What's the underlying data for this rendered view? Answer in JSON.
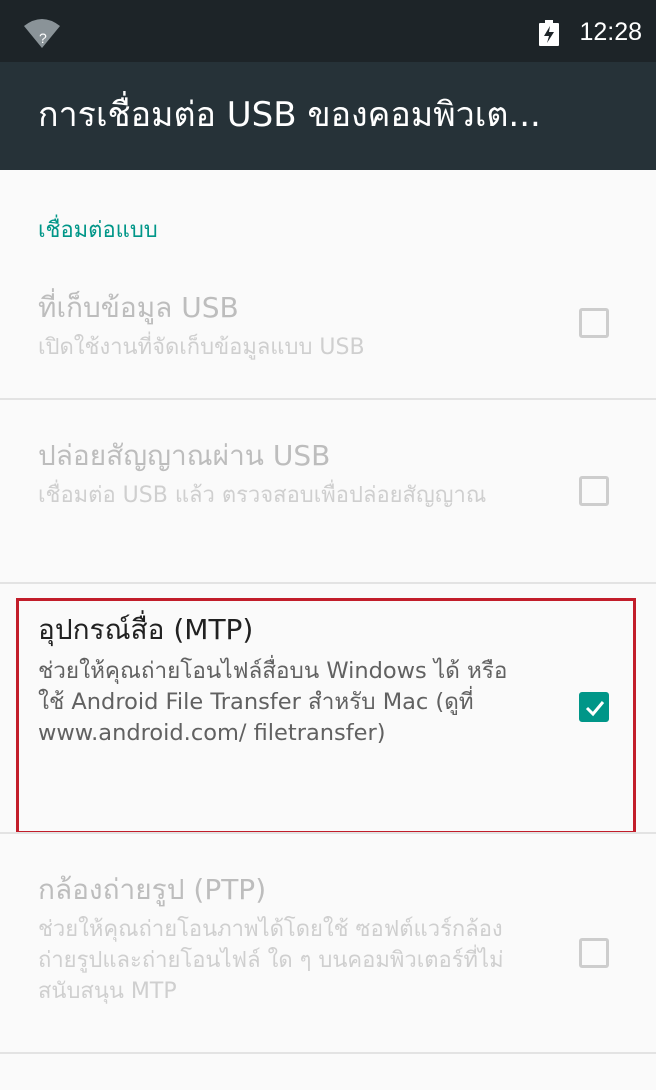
{
  "status_bar": {
    "wifi_icon": "wifi-unknown-icon",
    "battery_icon": "battery-charging-icon",
    "time": "12:28"
  },
  "toolbar": {
    "title": "การเชื่อมต่อ USB ของคอมพิวเต..."
  },
  "section": {
    "header": "เชื่อมต่อแบบ"
  },
  "options": [
    {
      "title": "ที่เก็บข้อมูล USB",
      "summary": "เปิดใช้งานที่จัดเก็บข้อมูลแบบ USB",
      "checked": false,
      "enabled": false
    },
    {
      "title": "ปล่อยสัญญาณผ่าน USB",
      "summary": "เชื่อมต่อ USB แล้ว ตรวจสอบเพื่อปล่อยสัญญาณ",
      "checked": false,
      "enabled": false
    },
    {
      "title": "อุปกรณ์สื่อ (MTP)",
      "summary": "ช่วยให้คุณถ่ายโอนไฟล์สื่อบน Windows ได้ หรือใช้ Android File Transfer สำหรับ Mac (ดูที่ www.android.com/ filetransfer)",
      "checked": true,
      "enabled": true,
      "highlighted": true
    },
    {
      "title": "กล้องถ่ายรูป (PTP)",
      "summary": "ช่วยให้คุณถ่ายโอนภาพได้โดยใช้ ซอฟต์แวร์กล้องถ่ายรูปและถ่ายโอนไฟล์ ใด ๆ บนคอมพิวเตอร์ที่ไม่สนับสนุน MTP",
      "checked": false,
      "enabled": false
    }
  ],
  "colors": {
    "accent": "#009688",
    "highlight_border": "#c21d2a",
    "toolbar": "#263238",
    "status_bar": "#1d2428"
  }
}
